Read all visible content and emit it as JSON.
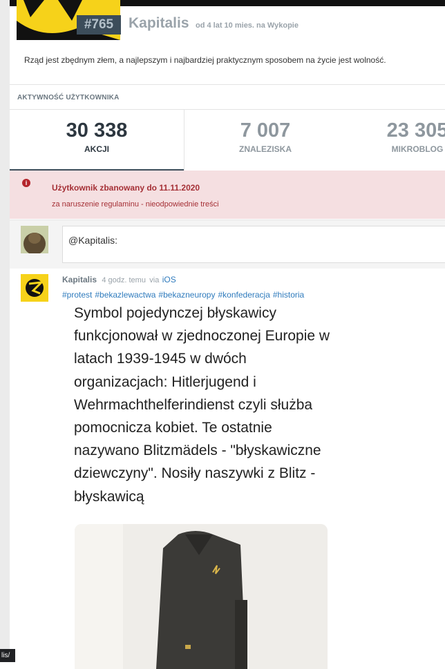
{
  "profile": {
    "rank": "#765",
    "username": "Kapitalis",
    "since": "od 4 lat 10 mies. na Wykopie",
    "motto": "Rząd jest zbędnym złem, a najlepszym i najbardziej praktycznym sposobem na życie jest wolność."
  },
  "activity": {
    "title": "AKTYWNOŚĆ UŻYTKOWNIKA",
    "stats": [
      {
        "value": "30 338",
        "label": "AKCJI"
      },
      {
        "value": "7 007",
        "label": "ZNALEZISKA"
      },
      {
        "value": "23 305",
        "label": "MIKROBLOG"
      }
    ]
  },
  "ban": {
    "icon": "info-icon",
    "title": "Użytkownik zbanowany do 11.11.2020",
    "reason": "za naruszenie regulaminu - nieodpowiednie treści"
  },
  "reply": {
    "value": "@Kapitalis:"
  },
  "post": {
    "author": "Kapitalis",
    "time": "4 godz. temu",
    "via": "via",
    "source": "iOS",
    "tags": [
      "#protest",
      "#bekazlewactwa",
      "#bekazneuropy",
      "#konfederacja",
      "#historia"
    ],
    "body": "Symbol pojedynczej błyskawicy funkcjonował w zjednoczonej Europie w latach 1939-1945 w dwóch organizacjach: Hitlerjugend i Wehrmachthelferindienst czyli służba pomocnicza kobiet. Te ostatnie nazywano Blitzmädels - \"błyskawiczne dziewczyny\". Nosiły naszywki z Blitz - błyskawicą"
  },
  "status_bar": {
    "url_fragment": "lis/"
  },
  "colors": {
    "accent": "#2f7bbd",
    "ban_background": "#f5dfe1",
    "ban_text": "#a53036",
    "rank_background": "#3c4d5a"
  }
}
